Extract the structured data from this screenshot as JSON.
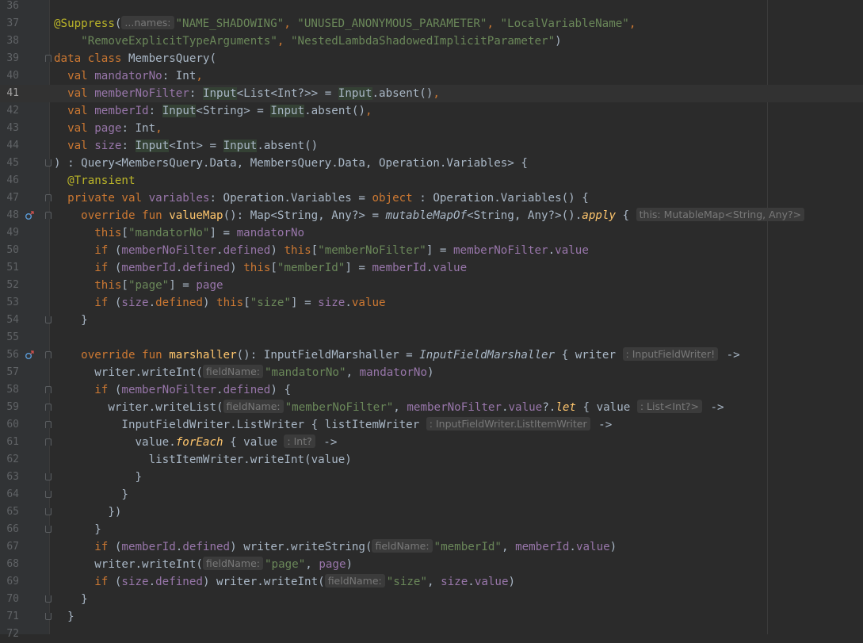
{
  "editor": {
    "lines": [
      {
        "num": "36",
        "segs": []
      },
      {
        "num": "37",
        "segs": [
          {
            "t": "@Suppress",
            "c": "ann"
          },
          {
            "t": "("
          },
          {
            "hint": "...names:"
          },
          {
            "t": "\"NAME_SHADOWING\"",
            "c": "str"
          },
          {
            "t": ", ",
            "c": "kw"
          },
          {
            "t": "\"UNUSED_ANONYMOUS_PARAMETER\"",
            "c": "str"
          },
          {
            "t": ", ",
            "c": "kw"
          },
          {
            "t": "\"LocalVariableName\"",
            "c": "str"
          },
          {
            "t": ",",
            "c": "kw"
          }
        ]
      },
      {
        "num": "38",
        "segs": [
          {
            "t": "    "
          },
          {
            "t": "\"RemoveExplicitTypeArguments\"",
            "c": "str"
          },
          {
            "t": ", ",
            "c": "kw"
          },
          {
            "t": "\"NestedLambdaShadowedImplicitParameter\"",
            "c": "str"
          },
          {
            "t": ")"
          }
        ]
      },
      {
        "num": "39",
        "segs": [
          {
            "t": "data class ",
            "c": "kw"
          },
          {
            "t": "MembersQuery("
          }
        ]
      },
      {
        "num": "40",
        "segs": [
          {
            "t": "  "
          },
          {
            "t": "val ",
            "c": "kw"
          },
          {
            "t": "mandatorNo",
            "c": "prop"
          },
          {
            "t": ": Int"
          },
          {
            "t": ",",
            "c": "kw"
          }
        ]
      },
      {
        "num": "41",
        "current": true,
        "segs": [
          {
            "t": "  "
          },
          {
            "t": "val ",
            "c": "kw"
          },
          {
            "t": "memberNoFilter",
            "c": "prop"
          },
          {
            "t": ": "
          },
          {
            "t": "Input",
            "c": "hl"
          },
          {
            "t": "<List<Int?>> = "
          },
          {
            "t": "Input",
            "c": "hl"
          },
          {
            "t": ".absent()"
          },
          {
            "t": ",",
            "c": "kw"
          }
        ]
      },
      {
        "num": "42",
        "segs": [
          {
            "t": "  "
          },
          {
            "t": "val ",
            "c": "kw"
          },
          {
            "t": "memberId",
            "c": "prop"
          },
          {
            "t": ": "
          },
          {
            "t": "Input",
            "c": "hl"
          },
          {
            "t": "<String> = "
          },
          {
            "t": "Input",
            "c": "hl"
          },
          {
            "t": ".absent()"
          },
          {
            "t": ",",
            "c": "kw"
          }
        ]
      },
      {
        "num": "43",
        "segs": [
          {
            "t": "  "
          },
          {
            "t": "val ",
            "c": "kw"
          },
          {
            "t": "page",
            "c": "prop"
          },
          {
            "t": ": Int"
          },
          {
            "t": ",",
            "c": "kw"
          }
        ]
      },
      {
        "num": "44",
        "segs": [
          {
            "t": "  "
          },
          {
            "t": "val ",
            "c": "kw"
          },
          {
            "t": "size",
            "c": "prop"
          },
          {
            "t": ": "
          },
          {
            "t": "Input",
            "c": "hl"
          },
          {
            "t": "<Int> = "
          },
          {
            "t": "Input",
            "c": "hl"
          },
          {
            "t": ".absent()"
          }
        ]
      },
      {
        "num": "45",
        "segs": [
          {
            "t": ") : Query<MembersQuery.Data, MembersQuery.Data, Operation.Variables> {"
          }
        ]
      },
      {
        "num": "46",
        "segs": [
          {
            "t": "  "
          },
          {
            "t": "@Transient",
            "c": "ann"
          }
        ]
      },
      {
        "num": "47",
        "segs": [
          {
            "t": "  "
          },
          {
            "t": "private val ",
            "c": "kw"
          },
          {
            "t": "variables",
            "c": "prop"
          },
          {
            "t": ": Operation.Variables = "
          },
          {
            "t": "object ",
            "c": "kw"
          },
          {
            "t": ": Operation.Variables() {"
          }
        ]
      },
      {
        "num": "48",
        "segs": [
          {
            "t": "    "
          },
          {
            "t": "override fun ",
            "c": "kw"
          },
          {
            "t": "valueMap",
            "c": "fn"
          },
          {
            "t": "(): Map<String, Any?> = "
          },
          {
            "t": "mutableMapOf",
            "c": "it"
          },
          {
            "t": "<String, Any?>()."
          },
          {
            "t": "apply",
            "c": "ext"
          },
          {
            "t": " { "
          },
          {
            "hint": "this: MutableMap<String, Any?>"
          }
        ]
      },
      {
        "num": "49",
        "segs": [
          {
            "t": "      "
          },
          {
            "t": "this",
            "c": "kw"
          },
          {
            "t": "["
          },
          {
            "t": "\"mandatorNo\"",
            "c": "str"
          },
          {
            "t": "] = "
          },
          {
            "t": "mandatorNo",
            "c": "prop"
          }
        ]
      },
      {
        "num": "50",
        "segs": [
          {
            "t": "      "
          },
          {
            "t": "if ",
            "c": "kw"
          },
          {
            "t": "("
          },
          {
            "t": "memberNoFilter",
            "c": "prop"
          },
          {
            "t": "."
          },
          {
            "t": "defined",
            "c": "prop"
          },
          {
            "t": ") "
          },
          {
            "t": "this",
            "c": "kw"
          },
          {
            "t": "["
          },
          {
            "t": "\"memberNoFilter\"",
            "c": "str"
          },
          {
            "t": "] = "
          },
          {
            "t": "memberNoFilter",
            "c": "prop"
          },
          {
            "t": "."
          },
          {
            "t": "value",
            "c": "prop"
          }
        ]
      },
      {
        "num": "51",
        "segs": [
          {
            "t": "      "
          },
          {
            "t": "if ",
            "c": "kw"
          },
          {
            "t": "("
          },
          {
            "t": "memberId",
            "c": "prop"
          },
          {
            "t": "."
          },
          {
            "t": "defined",
            "c": "prop"
          },
          {
            "t": ") "
          },
          {
            "t": "this",
            "c": "kw"
          },
          {
            "t": "["
          },
          {
            "t": "\"memberId\"",
            "c": "str"
          },
          {
            "t": "] = "
          },
          {
            "t": "memberId",
            "c": "prop"
          },
          {
            "t": "."
          },
          {
            "t": "value",
            "c": "prop"
          }
        ]
      },
      {
        "num": "52",
        "segs": [
          {
            "t": "      "
          },
          {
            "t": "this",
            "c": "kw"
          },
          {
            "t": "["
          },
          {
            "t": "\"page\"",
            "c": "str"
          },
          {
            "t": "] = "
          },
          {
            "t": "page",
            "c": "prop"
          }
        ]
      },
      {
        "num": "53",
        "segs": [
          {
            "t": "      "
          },
          {
            "t": "if ",
            "c": "kw"
          },
          {
            "t": "("
          },
          {
            "t": "size",
            "c": "prop"
          },
          {
            "t": "."
          },
          {
            "t": "defined",
            "c": "kw"
          },
          {
            "t": ") "
          },
          {
            "t": "this",
            "c": "kw"
          },
          {
            "t": "["
          },
          {
            "t": "\"size\"",
            "c": "str"
          },
          {
            "t": "] = "
          },
          {
            "t": "size",
            "c": "prop"
          },
          {
            "t": "."
          },
          {
            "t": "value",
            "c": "kw"
          }
        ]
      },
      {
        "num": "54",
        "segs": [
          {
            "t": "    }"
          }
        ]
      },
      {
        "num": "55",
        "segs": []
      },
      {
        "num": "56",
        "segs": [
          {
            "t": "    "
          },
          {
            "t": "override fun ",
            "c": "kw"
          },
          {
            "t": "marshaller",
            "c": "fn"
          },
          {
            "t": "(): InputFieldMarshaller = "
          },
          {
            "t": "InputFieldMarshaller",
            "c": "it"
          },
          {
            "t": " { writer "
          },
          {
            "hint": ": InputFieldWriter!"
          },
          {
            "t": " ->"
          }
        ]
      },
      {
        "num": "57",
        "segs": [
          {
            "t": "      writer.writeInt("
          },
          {
            "hint": "fieldName:"
          },
          {
            "t": "\"mandatorNo\"",
            "c": "str"
          },
          {
            "t": ", "
          },
          {
            "t": "mandatorNo",
            "c": "prop"
          },
          {
            "t": ")"
          }
        ]
      },
      {
        "num": "58",
        "segs": [
          {
            "t": "      "
          },
          {
            "t": "if ",
            "c": "kw"
          },
          {
            "t": "("
          },
          {
            "t": "memberNoFilter",
            "c": "prop"
          },
          {
            "t": "."
          },
          {
            "t": "defined",
            "c": "prop"
          },
          {
            "t": ") {"
          }
        ]
      },
      {
        "num": "59",
        "segs": [
          {
            "t": "        writer.writeList("
          },
          {
            "hint": "fieldName:"
          },
          {
            "t": "\"memberNoFilter\"",
            "c": "str"
          },
          {
            "t": ", "
          },
          {
            "t": "memberNoFilter",
            "c": "prop"
          },
          {
            "t": "."
          },
          {
            "t": "value",
            "c": "prop"
          },
          {
            "t": "?."
          },
          {
            "t": "let",
            "c": "ext"
          },
          {
            "t": " { value "
          },
          {
            "hint": ": List<Int?>"
          },
          {
            "t": " ->"
          }
        ]
      },
      {
        "num": "60",
        "segs": [
          {
            "t": "          InputFieldWriter.ListWriter { listItemWriter "
          },
          {
            "hint": ": InputFieldWriter.ListItemWriter"
          },
          {
            "t": " ->"
          }
        ]
      },
      {
        "num": "61",
        "segs": [
          {
            "t": "            value."
          },
          {
            "t": "forEach",
            "c": "ext"
          },
          {
            "t": " { value "
          },
          {
            "hint": ": Int?"
          },
          {
            "t": " ->"
          }
        ]
      },
      {
        "num": "62",
        "segs": [
          {
            "t": "              listItemWriter.writeInt(value)"
          }
        ]
      },
      {
        "num": "63",
        "segs": [
          {
            "t": "            }"
          }
        ]
      },
      {
        "num": "64",
        "segs": [
          {
            "t": "          }"
          }
        ]
      },
      {
        "num": "65",
        "segs": [
          {
            "t": "        })"
          }
        ]
      },
      {
        "num": "66",
        "segs": [
          {
            "t": "      }"
          }
        ]
      },
      {
        "num": "67",
        "segs": [
          {
            "t": "      "
          },
          {
            "t": "if ",
            "c": "kw"
          },
          {
            "t": "("
          },
          {
            "t": "memberId",
            "c": "prop"
          },
          {
            "t": "."
          },
          {
            "t": "defined",
            "c": "prop"
          },
          {
            "t": ") writer.writeString("
          },
          {
            "hint": "fieldName:"
          },
          {
            "t": "\"memberId\"",
            "c": "str"
          },
          {
            "t": ", "
          },
          {
            "t": "memberId",
            "c": "prop"
          },
          {
            "t": "."
          },
          {
            "t": "value",
            "c": "prop"
          },
          {
            "t": ")"
          }
        ]
      },
      {
        "num": "68",
        "segs": [
          {
            "t": "      writer.writeInt("
          },
          {
            "hint": "fieldName:"
          },
          {
            "t": "\"page\"",
            "c": "str"
          },
          {
            "t": ", "
          },
          {
            "t": "page",
            "c": "prop"
          },
          {
            "t": ")"
          }
        ]
      },
      {
        "num": "69",
        "segs": [
          {
            "t": "      "
          },
          {
            "t": "if ",
            "c": "kw"
          },
          {
            "t": "("
          },
          {
            "t": "size",
            "c": "prop"
          },
          {
            "t": "."
          },
          {
            "t": "defined",
            "c": "prop"
          },
          {
            "t": ") writer.writeInt("
          },
          {
            "hint": "fieldName:"
          },
          {
            "t": "\"size\"",
            "c": "str"
          },
          {
            "t": ", "
          },
          {
            "t": "size",
            "c": "prop"
          },
          {
            "t": "."
          },
          {
            "t": "value",
            "c": "prop"
          },
          {
            "t": ")"
          }
        ]
      },
      {
        "num": "70",
        "segs": [
          {
            "t": "    }"
          }
        ]
      },
      {
        "num": "71",
        "segs": [
          {
            "t": "  }"
          }
        ]
      },
      {
        "num": "72",
        "segs": []
      }
    ]
  },
  "gutter_icons": {
    "48": "override-marker-icon",
    "56": "override-marker-icon"
  },
  "fold_markers": {
    "39": "down",
    "45": "up",
    "47": "down",
    "48": "down",
    "54": "up",
    "56": "down",
    "58": "down",
    "59": "down",
    "60": "down",
    "61": "down",
    "63": "up",
    "64": "up",
    "65": "up",
    "66": "up",
    "70": "up",
    "71": "up"
  },
  "colors": {
    "background": "#2b2b2b",
    "keyword": "#cc7832",
    "string": "#6a8759",
    "property": "#9876aa",
    "function": "#ffc66d",
    "annotation": "#bbb529"
  }
}
